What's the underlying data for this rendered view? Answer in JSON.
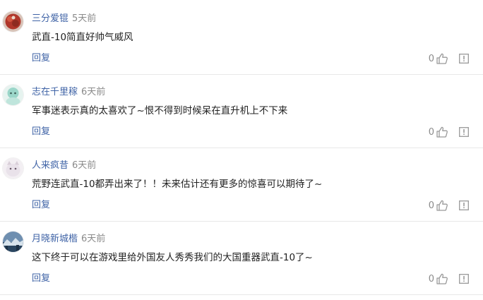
{
  "comments": [
    {
      "user": "三分爱锟",
      "time": "5天前",
      "text": "武直-10简直好帅气威风",
      "reply_label": "回复",
      "likes": "0",
      "avatar_icon": "avatar-red-flower",
      "avatar_color": "#b0362a"
    },
    {
      "user": "志在千里稼",
      "time": "6天前",
      "text": "军事迷表示真的太喜欢了~恨不得到时候呆在直升机上不下来",
      "reply_label": "回复",
      "likes": "0",
      "avatar_icon": "avatar-cartoon-girl",
      "avatar_color": "#9bd6c9"
    },
    {
      "user": "人来疯昔",
      "time": "6天前",
      "text": "荒野连武直-10都弄出来了！！未来估计还有更多的惊喜可以期待了~",
      "reply_label": "回复",
      "likes": "0",
      "avatar_icon": "avatar-white-cat",
      "avatar_color": "#e9e2ea"
    },
    {
      "user": "月晓新城楷",
      "time": "6天前",
      "text": "这下终于可以在游戏里给外国友人秀秀我们的大国重器武直-10了~",
      "reply_label": "回复",
      "likes": "0",
      "avatar_icon": "avatar-landscape",
      "avatar_color": "#33506e"
    }
  ],
  "icons": {
    "like": "thumbs-up-icon",
    "report": "report-icon"
  },
  "colors": {
    "username": "#3f63a6",
    "reply": "#3f63a6",
    "meta": "#8a8a8a",
    "divider": "#e8e8e8"
  }
}
